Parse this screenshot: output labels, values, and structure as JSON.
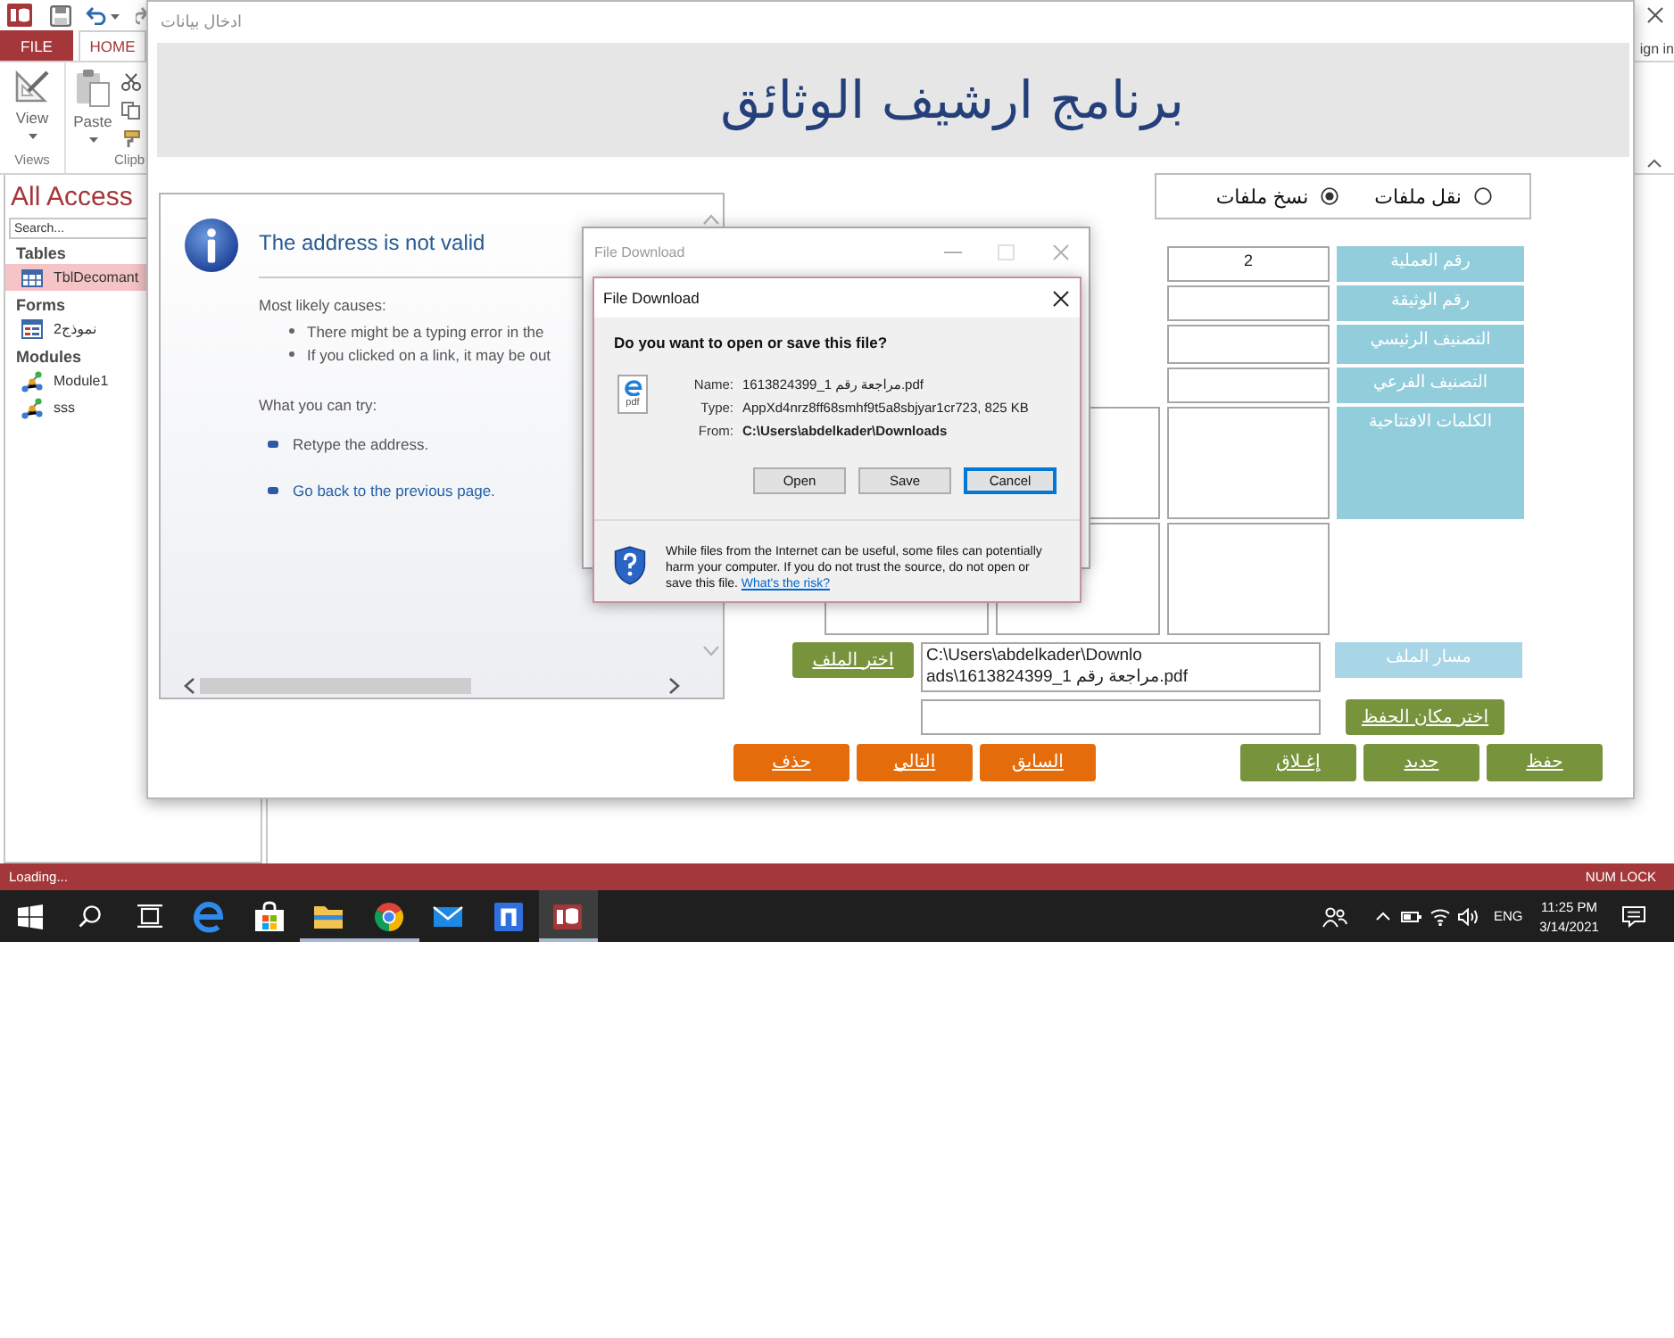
{
  "ribbon": {
    "tabs": [
      {
        "label": "HOME",
        "kind": "tab",
        "selected": true
      },
      {
        "label": "FILE",
        "kind": "file",
        "selected": false
      }
    ],
    "account": "ign in",
    "groups": [
      {
        "label": "Clipb",
        "buttons": [
          "Paste"
        ]
      },
      {
        "label": "Views",
        "buttons": [
          "View"
        ]
      }
    ]
  },
  "nav_pane": {
    "title": "All Access",
    "search": {
      "placeholder": "Search..."
    },
    "groups": [
      {
        "label": "Tables",
        "items": [
          {
            "label": "TblDecomant",
            "kind": "table",
            "selected": true
          }
        ]
      },
      {
        "label": "Forms",
        "items": [
          {
            "label": "نموذج2",
            "kind": "form",
            "selected": false
          }
        ]
      },
      {
        "label": "Modules",
        "items": [
          {
            "label": "Module1",
            "kind": "module",
            "selected": false
          },
          {
            "label": "sss",
            "kind": "module",
            "selected": false
          }
        ]
      }
    ]
  },
  "form": {
    "title": "ادخال بيانات",
    "heading": "برنامج ارشيف الوثائق",
    "browser": {
      "heading": "The address is not valid",
      "causes_title": "Most likely causes:",
      "causes": [
        "There might be a typing error in the",
        "If you clicked on a link, it may be out"
      ],
      "try_title": "What you can try:",
      "actions": [
        {
          "label": "Retype the address.",
          "kind": "text"
        },
        {
          "label": "Go back to the previous page.",
          "kind": "link"
        }
      ]
    },
    "mode_options": [
      {
        "label": "نقل ملفات",
        "selected": false
      },
      {
        "label": "نسخ ملفات",
        "selected": true
      }
    ],
    "fields": [
      {
        "label": "رقم العملية",
        "value": "2"
      },
      {
        "label": "رقم الوثيقة"
      },
      {
        "label": "التصنيف الرئيسي"
      },
      {
        "label": "التصنيف الفرعي"
      },
      {
        "label": "الكلمات الافتتاحية"
      }
    ],
    "file_path": {
      "button": "اختر الملف",
      "value_lines": [
        "C:\\Users\\abdelkader\\Downlo",
        "ads\\1613824399_مراجعة رقم 1.pdf"
      ],
      "label": "مسار الملف"
    },
    "save_location": {
      "button": "اختر مكان الحفظ"
    },
    "record_buttons": [
      "حفظ",
      "جديد",
      "إغـلاق"
    ],
    "navigation_buttons": [
      "السابق",
      "التالي",
      "حذف"
    ]
  },
  "download_dialog": {
    "outer_title": "File Download",
    "title": "File Download",
    "question": "Do you want to open or save this file?",
    "file": {
      "type_label": "pdf",
      "field_names": [
        "Name:",
        "Type:",
        "From:"
      ],
      "field_values": [
        {
          "text": "1613824399_مراجعة رقم 1.pdf",
          "bold": false
        },
        {
          "text": "AppXd4nrz8ff68smhf9t5a8sbjyar1cr723, 825 KB",
          "bold": false
        },
        {
          "text": "C:\\Users\\abdelkader\\Downloads",
          "bold": true
        }
      ]
    },
    "buttons": [
      {
        "label": "Cancel",
        "selected": true
      },
      {
        "label": "Save",
        "selected": false
      },
      {
        "label": "Open",
        "selected": false
      }
    ],
    "warning": "While files from the Internet can be useful, some files can potentially harm your computer. If you do not trust the source, do not open or save this file.",
    "risk_link": "What's the risk?"
  },
  "status_bar": {
    "left": "Loading...",
    "right": "NUM LOCK"
  },
  "taskbar": {
    "apps": [
      {
        "running": false,
        "selected": false
      },
      {
        "running": false,
        "selected": false
      },
      {
        "running": true,
        "selected": false
      },
      {
        "running": true,
        "selected": false
      },
      {
        "running": false,
        "selected": false
      },
      {
        "running": false,
        "selected": false
      },
      {
        "running": true,
        "selected": true
      }
    ],
    "language": "ENG",
    "time": "11:25 PM",
    "date": "3/14/2021"
  }
}
